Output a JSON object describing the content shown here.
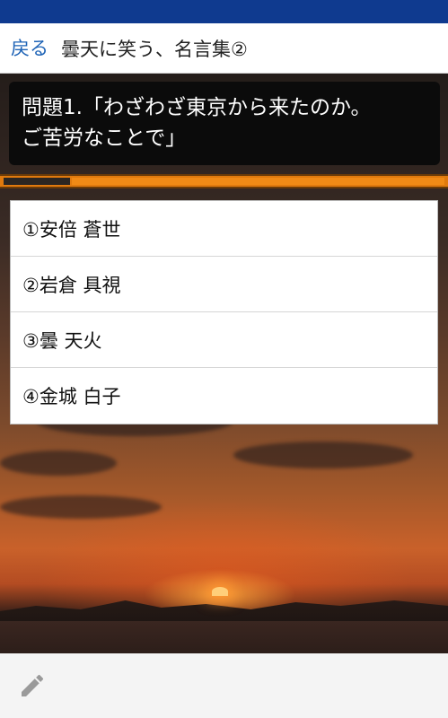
{
  "header": {
    "back_label": "戻る",
    "title": "曇天に笑う、名言集②"
  },
  "question": {
    "line1": "問題1.「わざわざ東京から来たのか。",
    "line2": "ご苦労なことで」"
  },
  "progress": {
    "fraction": 0.15
  },
  "answers": [
    {
      "label": "①安倍 蒼世"
    },
    {
      "label": "②岩倉 具視"
    },
    {
      "label": "③曇 天火"
    },
    {
      "label": "④金城 白子"
    }
  ],
  "colors": {
    "status_bar": "#0f3a8f",
    "back_link": "#1e63b6",
    "progress_bar": "#e07a0e"
  },
  "icons": {
    "edit": "pencil-icon"
  }
}
